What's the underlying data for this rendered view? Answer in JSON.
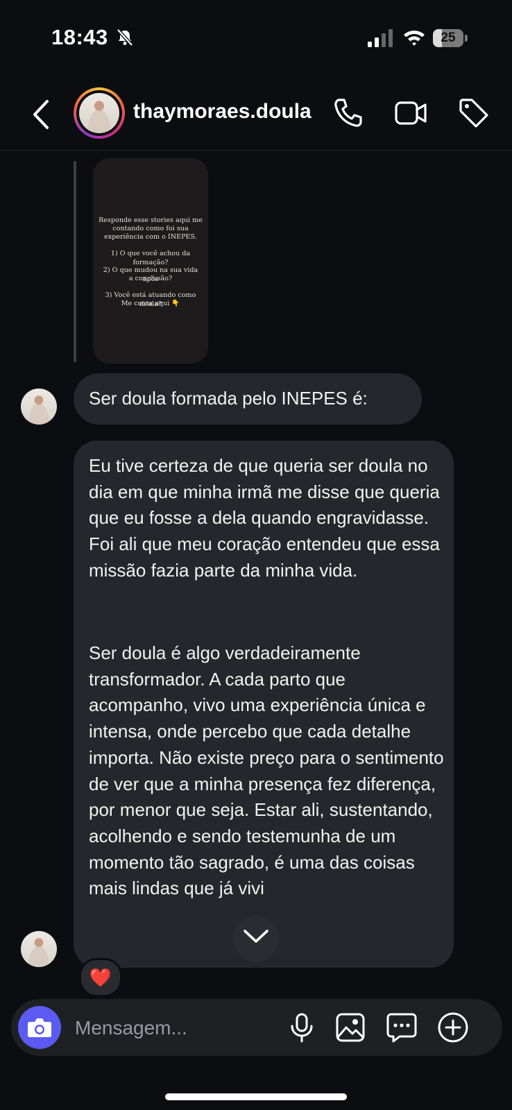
{
  "status_bar": {
    "time": "18:43",
    "battery_level": "25",
    "icons": [
      "bell-slash-icon",
      "cellular-signal-icon",
      "wifi-icon",
      "battery-icon"
    ]
  },
  "header": {
    "username": "thaymoraes.doula",
    "icons": [
      "chevron-left-icon",
      "phone-icon",
      "video-camera-icon",
      "tag-icon"
    ],
    "story_ring_colors": [
      "#f9c440",
      "#f56040",
      "#d02a8c",
      "#8e3cc8"
    ]
  },
  "story_reply": {
    "lines": [
      "Responde esse stories aqui me",
      "contando como foi sua",
      "experiência com o INEPES.",
      "1) O que você achou da formação?",
      "2) O que mudou na sua vida após",
      "a conclusão?",
      "3) Você está atuando como doula?",
      "Me conta aqui 👇"
    ]
  },
  "messages": [
    {
      "text": "Ser doula formada pelo INEPES é:"
    },
    {
      "paragraphs": [
        "Eu tive certeza de que queria ser doula no dia em que minha irmã me disse que queria que eu fosse a dela quando engravidasse. Foi ali que meu coração entendeu que essa missão fazia parte da minha vida.",
        "Ser doula é algo verdadeiramente transformador. A cada parto que acompanho, vivo uma experiência única e intensa, onde percebo que cada detalhe importa. Não existe preço para o sentimento de ver que a minha presença fez diferença, por menor que seja. Estar ali, sustentando, acolhendo e sendo testemunha de um momento tão sagrado, é uma das coisas mais lindas que já vivi"
      ],
      "reaction": "❤️"
    }
  ],
  "composer": {
    "placeholder": "Mensagem...",
    "icons": [
      "camera-icon",
      "microphone-icon",
      "gallery-icon",
      "sticker-chat-icon",
      "plus-circle-icon"
    ],
    "accent_color": "#5b5bf2"
  }
}
